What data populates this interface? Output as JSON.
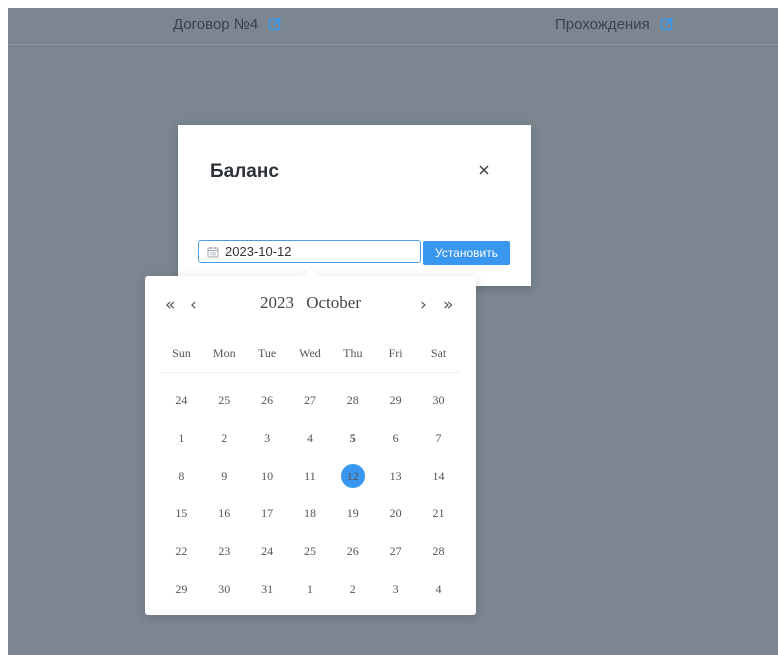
{
  "header": {
    "contract_label": "Договор №4",
    "passings_label": "Прохождения"
  },
  "modal": {
    "title": "Баланс",
    "close_glyph": "×",
    "date_value": "2023-10-12",
    "set_button_label": "Установить"
  },
  "datepicker": {
    "year": "2023",
    "month": "October",
    "nav": {
      "prev_year": "«",
      "prev_month": "‹",
      "next_month": "›",
      "next_year": "»"
    },
    "weekdays": [
      "Sun",
      "Mon",
      "Tue",
      "Wed",
      "Thu",
      "Fri",
      "Sat"
    ],
    "weeks": [
      [
        {
          "d": "24",
          "t": "other"
        },
        {
          "d": "25",
          "t": "other"
        },
        {
          "d": "26",
          "t": "other"
        },
        {
          "d": "27",
          "t": "other"
        },
        {
          "d": "28",
          "t": "other"
        },
        {
          "d": "29",
          "t": "other"
        },
        {
          "d": "30",
          "t": "other"
        }
      ],
      [
        {
          "d": "1",
          "t": ""
        },
        {
          "d": "2",
          "t": ""
        },
        {
          "d": "3",
          "t": ""
        },
        {
          "d": "4",
          "t": ""
        },
        {
          "d": "5",
          "t": "today"
        },
        {
          "d": "6",
          "t": ""
        },
        {
          "d": "7",
          "t": ""
        }
      ],
      [
        {
          "d": "8",
          "t": ""
        },
        {
          "d": "9",
          "t": ""
        },
        {
          "d": "10",
          "t": ""
        },
        {
          "d": "11",
          "t": ""
        },
        {
          "d": "12",
          "t": "selected"
        },
        {
          "d": "13",
          "t": ""
        },
        {
          "d": "14",
          "t": ""
        }
      ],
      [
        {
          "d": "15",
          "t": ""
        },
        {
          "d": "16",
          "t": ""
        },
        {
          "d": "17",
          "t": ""
        },
        {
          "d": "18",
          "t": ""
        },
        {
          "d": "19",
          "t": ""
        },
        {
          "d": "20",
          "t": ""
        },
        {
          "d": "21",
          "t": ""
        }
      ],
      [
        {
          "d": "22",
          "t": ""
        },
        {
          "d": "23",
          "t": ""
        },
        {
          "d": "24",
          "t": ""
        },
        {
          "d": "25",
          "t": ""
        },
        {
          "d": "26",
          "t": ""
        },
        {
          "d": "27",
          "t": ""
        },
        {
          "d": "28",
          "t": ""
        }
      ],
      [
        {
          "d": "29",
          "t": ""
        },
        {
          "d": "30",
          "t": ""
        },
        {
          "d": "31",
          "t": ""
        },
        {
          "d": "1",
          "t": "other"
        },
        {
          "d": "2",
          "t": "other"
        },
        {
          "d": "3",
          "t": "other"
        },
        {
          "d": "4",
          "t": "other"
        }
      ]
    ]
  },
  "colors": {
    "overlay": "#7b8691",
    "accent": "#3a97ef",
    "edit_icon": "#3a97ef"
  },
  "icons": {
    "header_edit": "edit-icon",
    "close": "close-icon",
    "date_input": "calendar-icon"
  }
}
